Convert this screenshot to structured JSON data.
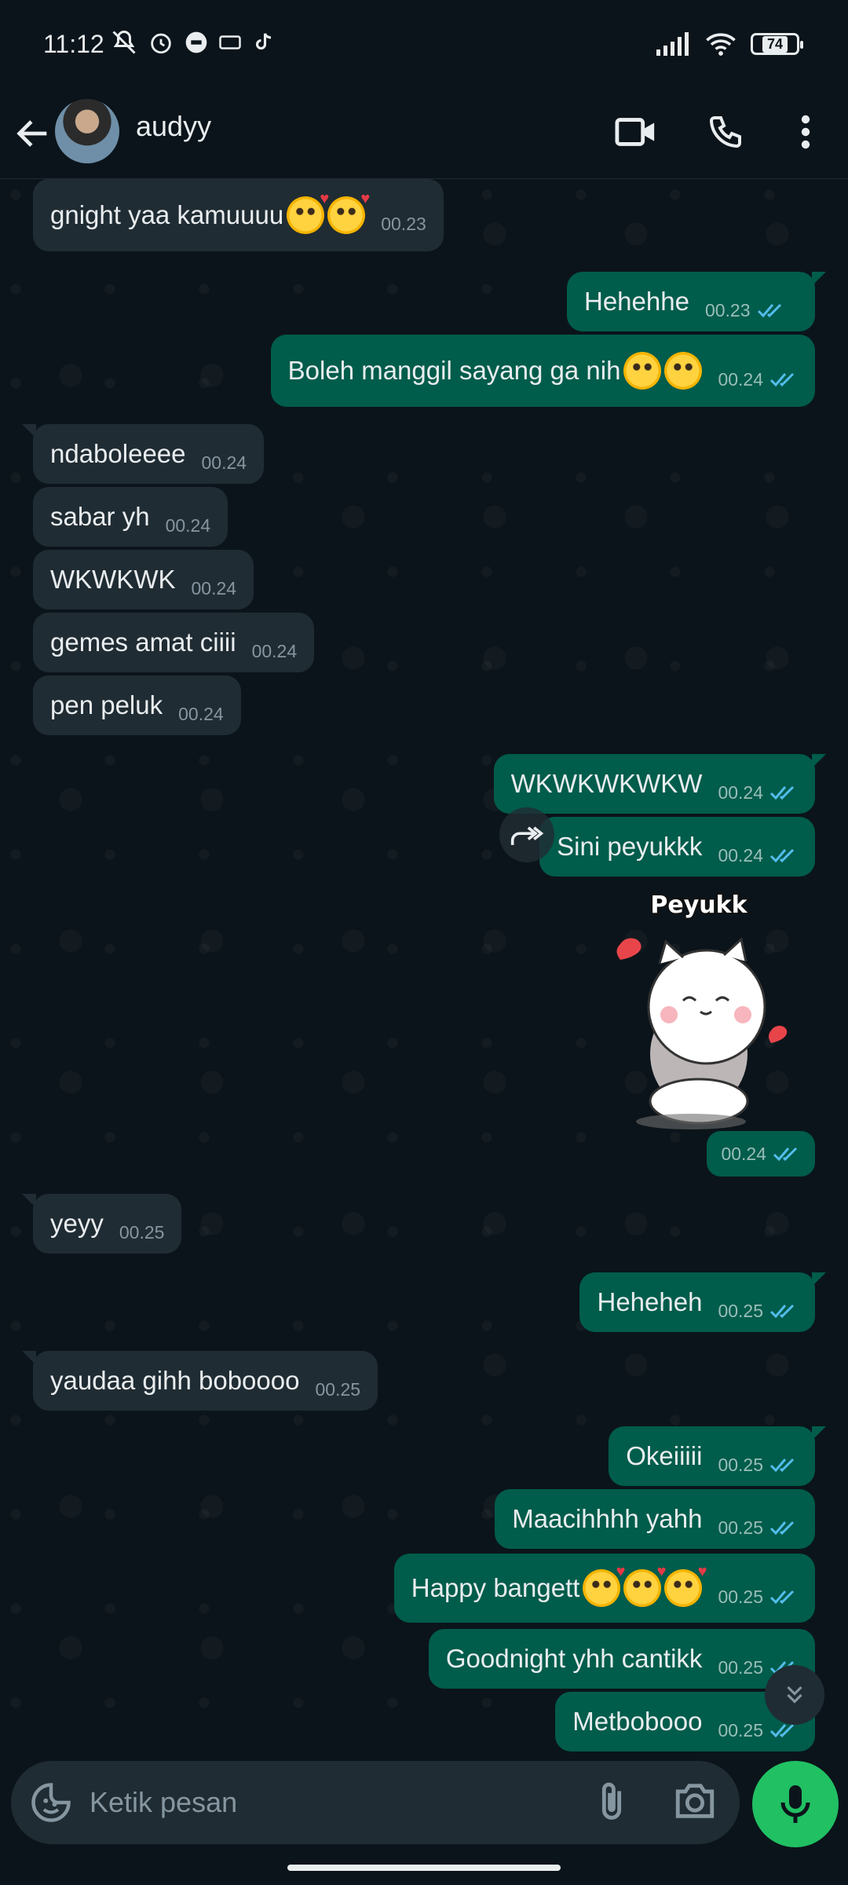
{
  "status_bar": {
    "time": "11:12",
    "battery": "74"
  },
  "header": {
    "contact_name": "audyy"
  },
  "messages": [
    {
      "text": "gnight yaa kamuuuu",
      "time": "00.23"
    },
    {
      "text": "Hehehhe",
      "time": "00.23"
    },
    {
      "text": "Boleh manggil sayang ga nih",
      "time": "00.24"
    },
    {
      "text": "ndaboleeee",
      "time": "00.24"
    },
    {
      "text": "sabar yh",
      "time": "00.24"
    },
    {
      "text": "WKWKWK",
      "time": "00.24"
    },
    {
      "text": "gemes amat ciiii",
      "time": "00.24"
    },
    {
      "text": "pen peluk",
      "time": "00.24"
    },
    {
      "text": "WKWKWKWKW",
      "time": "00.24"
    },
    {
      "text": "Sini peyukkk",
      "time": "00.24"
    },
    {
      "text": "yeyy",
      "time": "00.25"
    },
    {
      "text": "Heheheh",
      "time": "00.25"
    },
    {
      "text": "yaudaa gihh boboooo",
      "time": "00.25"
    },
    {
      "text": "Okeiiiii",
      "time": "00.25"
    },
    {
      "text": "Maacihhhh yahh",
      "time": "00.25"
    },
    {
      "text": "Happy bangett",
      "time": "00.25"
    },
    {
      "text": "Goodnight yhh cantikk",
      "time": "00.25"
    },
    {
      "text": "Metbobooo",
      "time": "00.25"
    }
  ],
  "sticker": {
    "caption": "Peyukk",
    "time": "00.24"
  },
  "input": {
    "placeholder": "Ketik pesan"
  },
  "colors": {
    "incoming_bubble": "#202c33",
    "outgoing_bubble": "#005c4b",
    "read_ticks": "#53bdeb",
    "accent": "#21c063"
  }
}
